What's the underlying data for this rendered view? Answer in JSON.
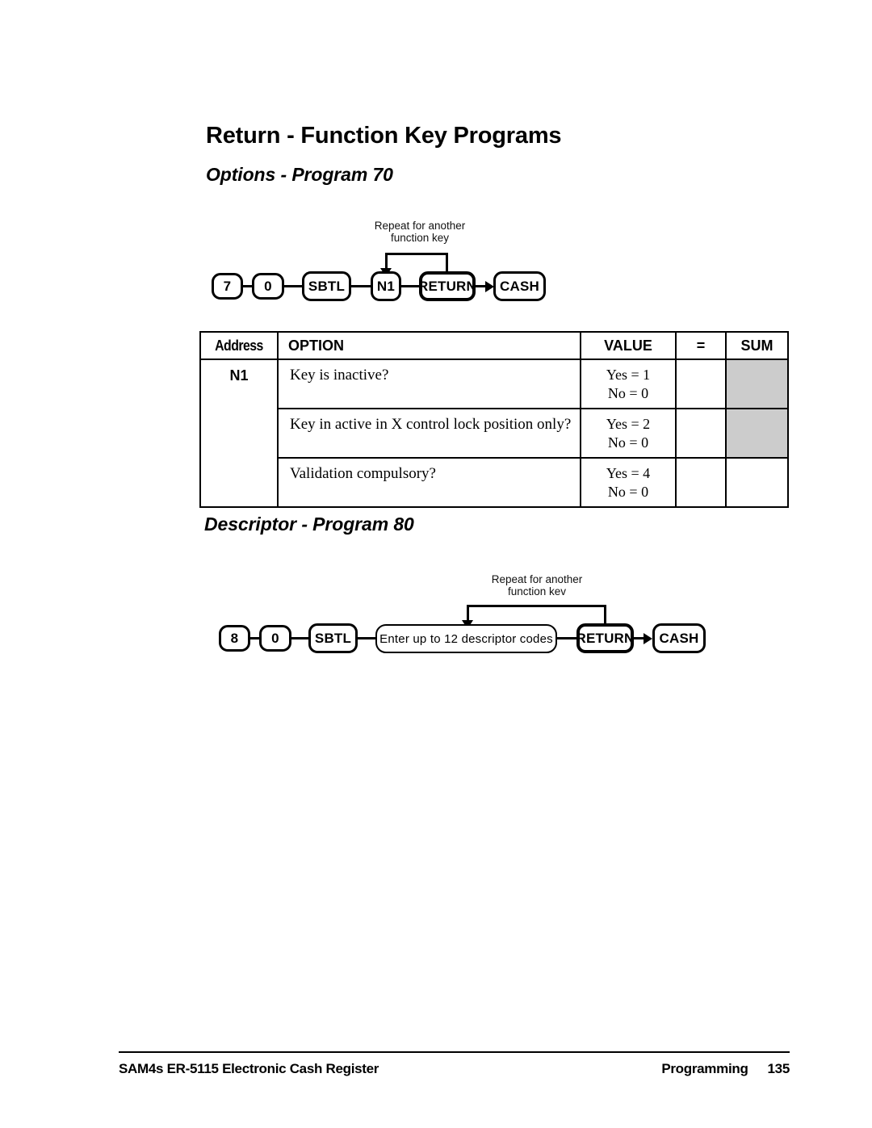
{
  "page": {
    "title": "Return - Function Key Programs"
  },
  "sections": [
    {
      "heading": "Options - Program 70",
      "diagram": {
        "loop_label_line1": "Repeat for another",
        "loop_label_line2": "function key",
        "nodes": [
          {
            "label": "7"
          },
          {
            "label": "0"
          },
          {
            "label": "SBTL"
          },
          {
            "label": "N1"
          },
          {
            "label": "RETURN"
          },
          {
            "label": "CASH"
          }
        ]
      }
    },
    {
      "heading": "Descriptor - Program 80",
      "diagram": {
        "loop_label_line1": "Repeat for another",
        "loop_label_line2": "function kev",
        "nodes": [
          {
            "label": "8"
          },
          {
            "label": "0"
          },
          {
            "label": "SBTL"
          },
          {
            "label": "Enter up to 12 descriptor codes"
          },
          {
            "label": "RETURN"
          },
          {
            "label": "CASH"
          }
        ]
      }
    }
  ],
  "option_table": {
    "headers": {
      "address": "Address",
      "option": "OPTION",
      "value": "VALUE",
      "equals": "=",
      "sum": "SUM"
    },
    "address": "N1",
    "rows": [
      {
        "option": "Key is inactive?",
        "value_yes": "Yes = 1",
        "value_no": "No = 0",
        "equals": "",
        "sum": ""
      },
      {
        "option": "Key in active in X control lock position only?",
        "value_yes": "Yes = 2",
        "value_no": "No = 0",
        "equals": "",
        "sum": ""
      },
      {
        "option": "Validation compulsory?",
        "value_yes": "Yes = 4",
        "value_no": "No = 0",
        "equals": "",
        "sum": ""
      }
    ],
    "shade_color": "#cccccc"
  },
  "footer": {
    "left": "SAM4s ER-5115 Electronic Cash Register",
    "section": "Programming",
    "page_number": "135"
  }
}
